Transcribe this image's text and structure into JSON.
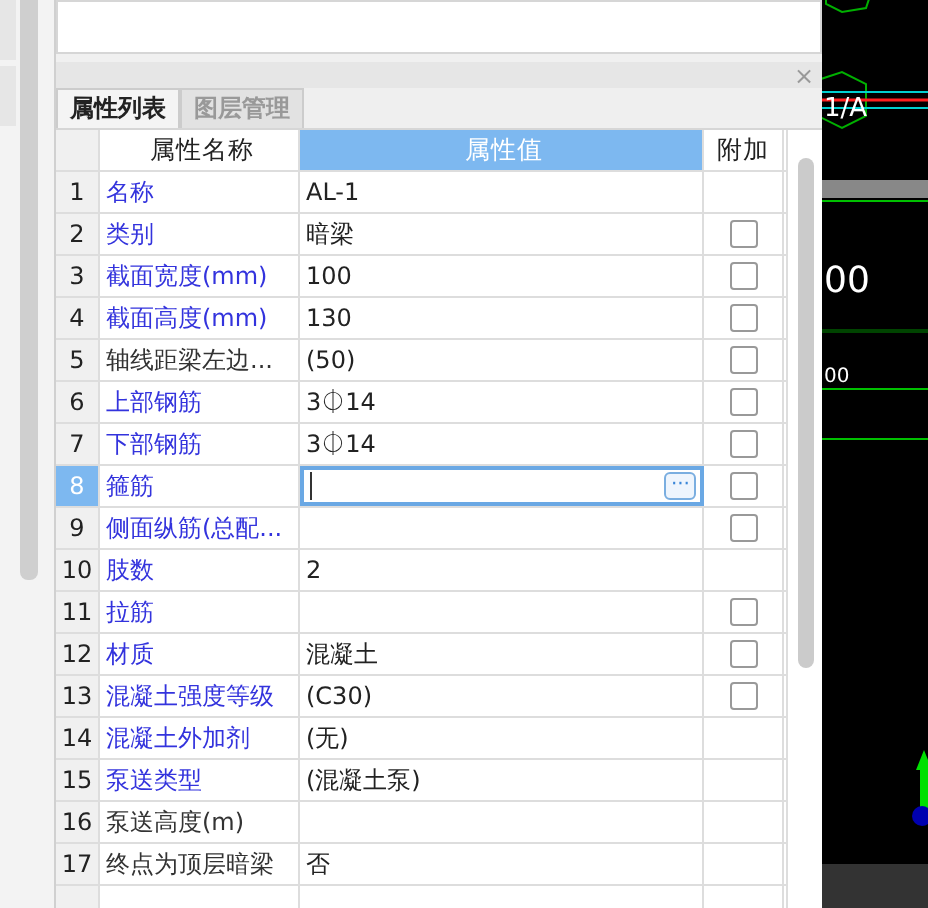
{
  "panel": {
    "close_glyph": "×"
  },
  "tabs": [
    {
      "label": "属性列表",
      "selected": true
    },
    {
      "label": "图层管理",
      "selected": false
    }
  ],
  "table": {
    "columns": [
      {
        "label": "属性名称",
        "selected": false
      },
      {
        "label": "属性值",
        "selected": true
      },
      {
        "label": "附加",
        "selected": false
      }
    ],
    "rows": [
      {
        "number": "1",
        "name": "名称",
        "color": "#3333dd",
        "value": "AL-1",
        "selected": false
      },
      {
        "number": "2",
        "name": "类别",
        "color": "#3333dd",
        "value": "暗梁",
        "selected": false,
        "checked": false
      },
      {
        "number": "3",
        "name": "截面宽度(mm)",
        "color": "#3333dd",
        "value": "100",
        "selected": false,
        "checked": false
      },
      {
        "number": "4",
        "name": "截面高度(mm)",
        "color": "#3333dd",
        "value": "130",
        "selected": false,
        "checked": false
      },
      {
        "number": "5",
        "name": "轴线距梁左边...",
        "color": "#333333",
        "value": "(50)",
        "selected": false,
        "checked": false
      },
      {
        "number": "6",
        "name": "上部钢筋",
        "color": "#3333dd",
        "value": "3⏀14",
        "selected": false,
        "checked": false
      },
      {
        "number": "7",
        "name": "下部钢筋",
        "color": "#3333dd",
        "value": "3⏀14",
        "selected": false,
        "checked": false
      },
      {
        "number": "8",
        "name": "箍筋",
        "color": "#3333dd",
        "value": "",
        "selected": true,
        "button": "···",
        "checked": false
      },
      {
        "number": "9",
        "name": "侧面纵筋(总配...",
        "color": "#3333dd",
        "value": "",
        "selected": false,
        "checked": false
      },
      {
        "number": "10",
        "name": "肢数",
        "color": "#3333dd",
        "value": "2",
        "selected": false
      },
      {
        "number": "11",
        "name": "拉筋",
        "color": "#3333dd",
        "value": "",
        "selected": false,
        "checked": false
      },
      {
        "number": "12",
        "name": "材质",
        "color": "#3333dd",
        "value": "混凝土",
        "selected": false,
        "checked": false
      },
      {
        "number": "13",
        "name": "混凝土强度等级",
        "color": "#3333dd",
        "value": "(C30)",
        "selected": false,
        "checked": false
      },
      {
        "number": "14",
        "name": "混凝土外加剂",
        "color": "#3333dd",
        "value": "(无)",
        "selected": false
      },
      {
        "number": "15",
        "name": "泵送类型",
        "color": "#3333dd",
        "value": "(混凝土泵)",
        "selected": false
      },
      {
        "number": "16",
        "name": "泵送高度(m)",
        "color": "#333333",
        "value": "",
        "selected": false
      },
      {
        "number": "17",
        "name": "终点为顶层暗梁",
        "color": "#333333",
        "value": "否",
        "selected": false
      }
    ]
  },
  "canvas": {
    "labels": [
      {
        "text": "1/A",
        "kind": "axis"
      },
      {
        "text": "00",
        "kind": "large"
      },
      {
        "text": "00",
        "kind": "small"
      }
    ]
  }
}
